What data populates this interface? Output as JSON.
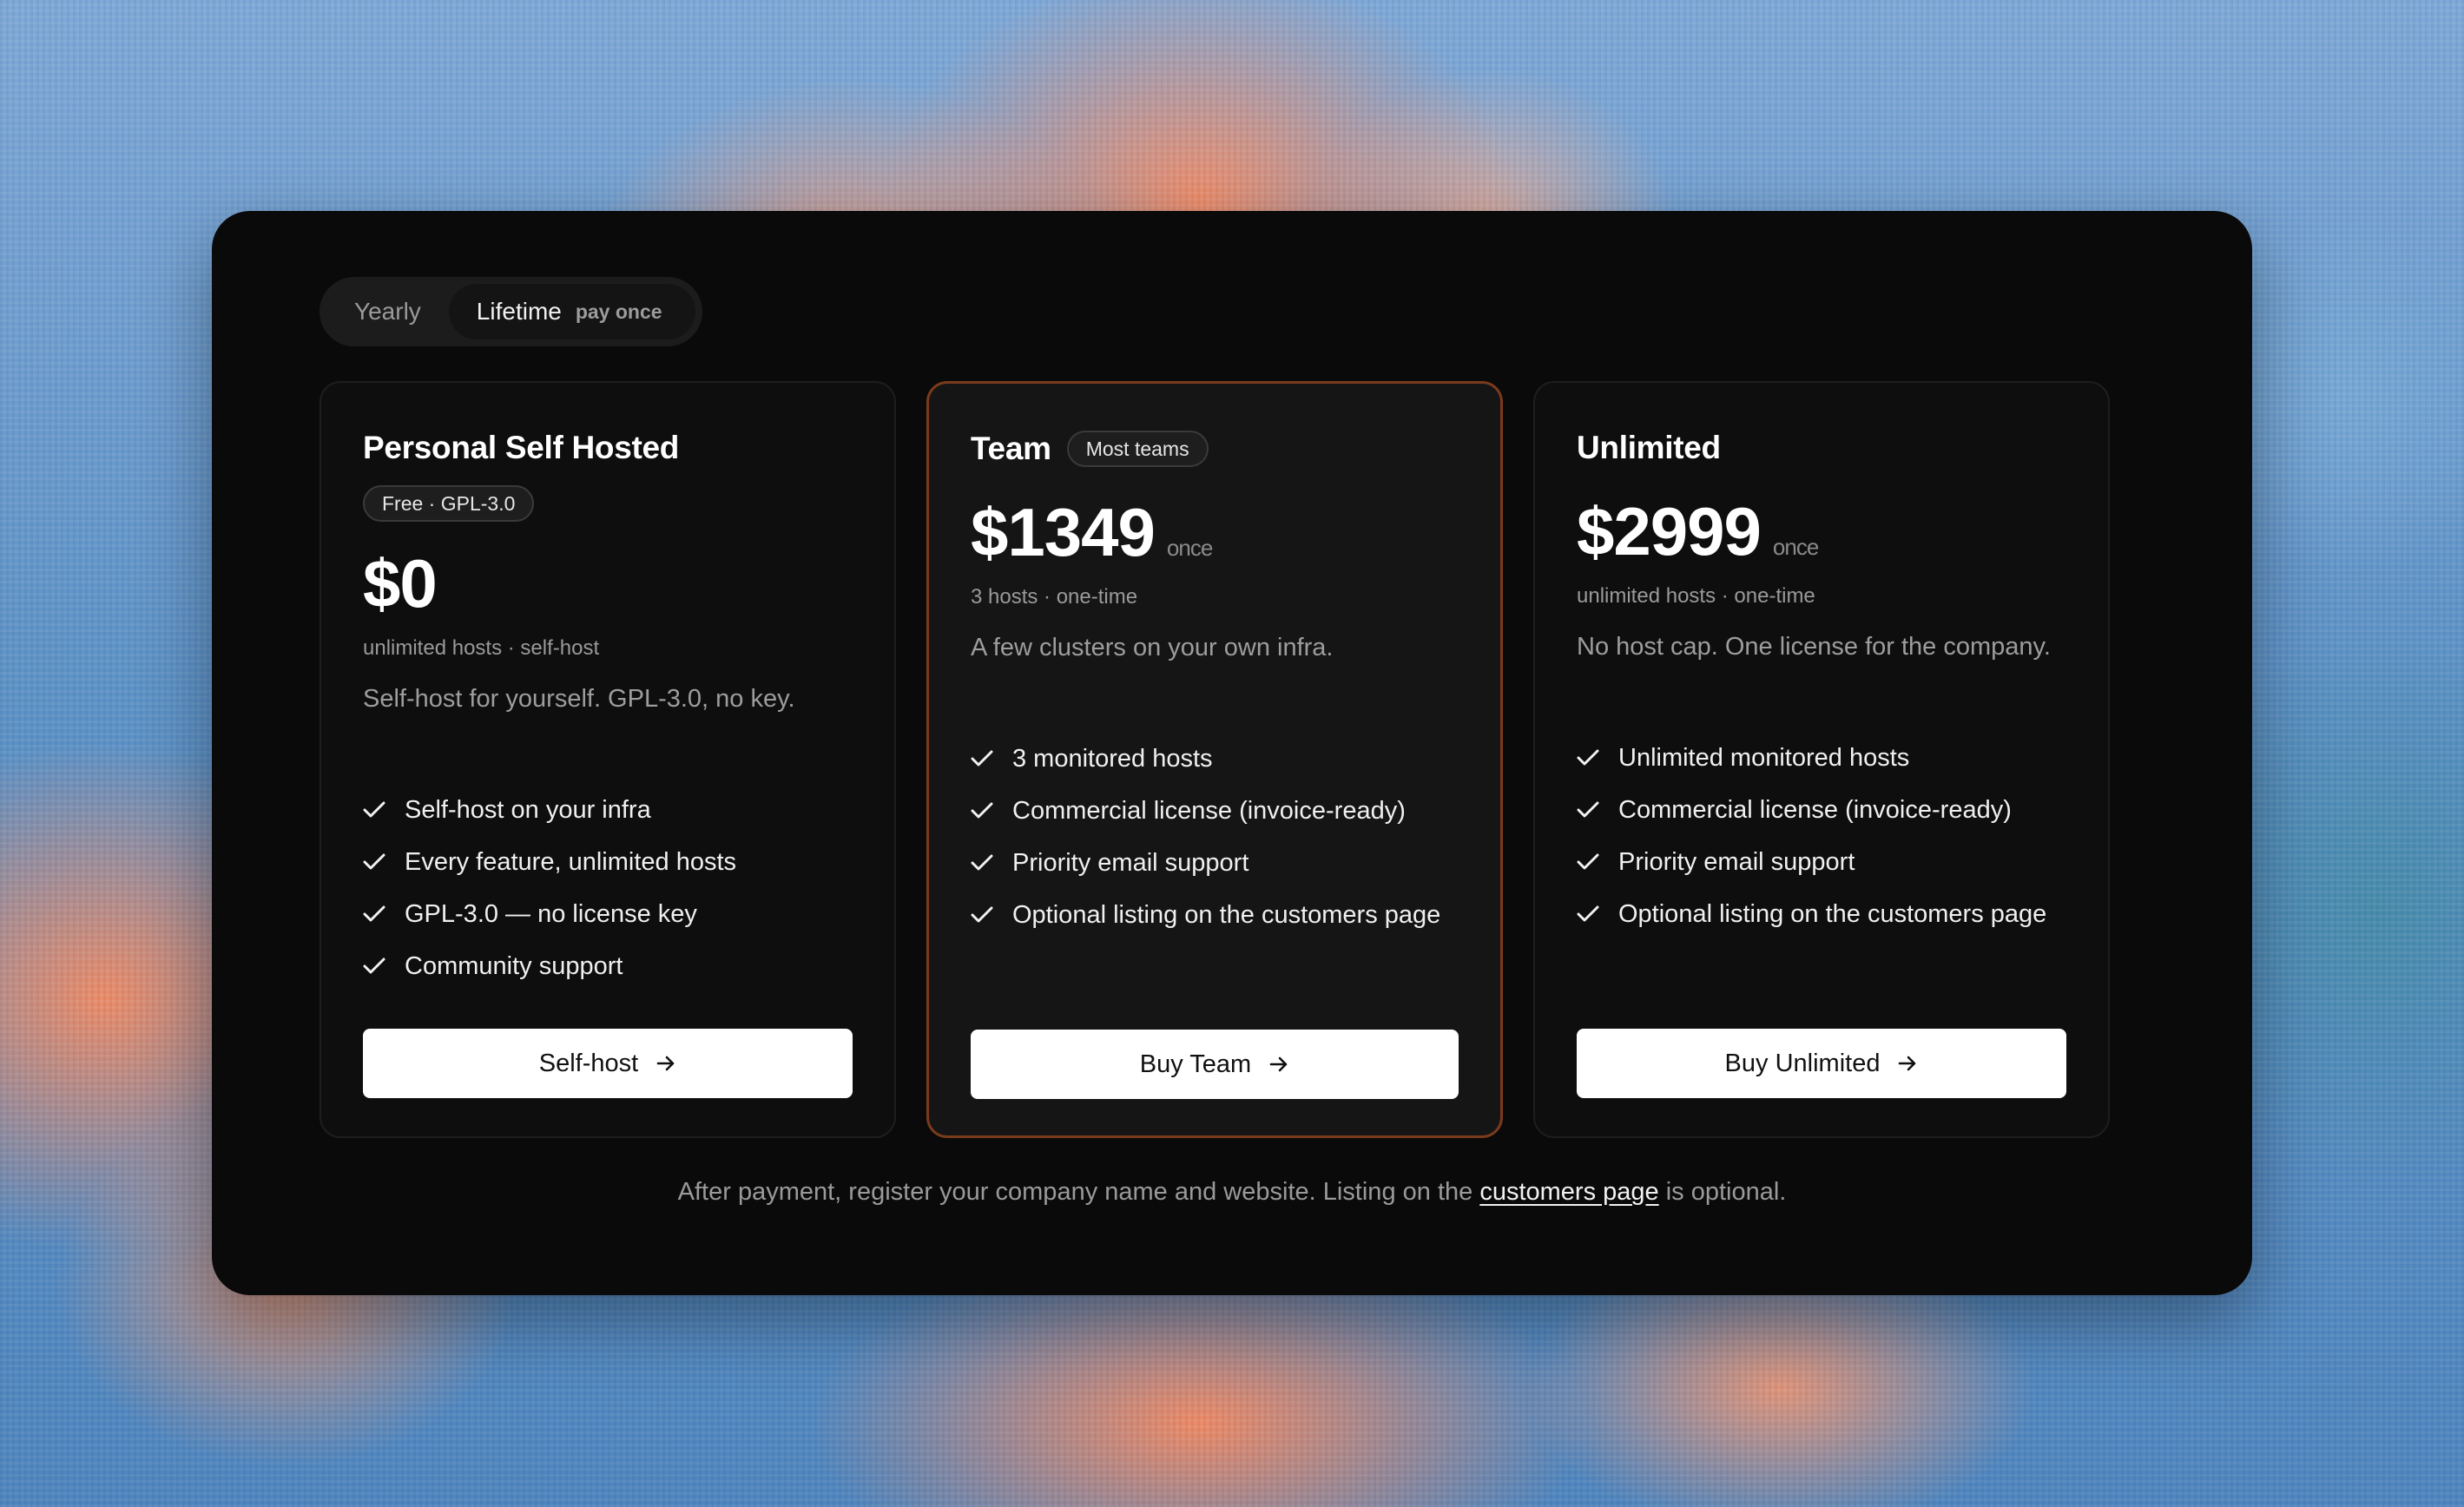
{
  "billing_toggle": {
    "yearly_label": "Yearly",
    "lifetime_label": "Lifetime",
    "lifetime_tag": "pay once",
    "selected": "Lifetime"
  },
  "plans": [
    {
      "name": "Personal Self Hosted",
      "badge": "Free · GPL-3.0",
      "price": "$0",
      "meta": "unlimited hosts · self-host",
      "description": "Self-host for yourself. GPL-3.0, no key.",
      "features": [
        "Self-host on your infra",
        "Every feature, unlimited hosts",
        "GPL-3.0 — no license key",
        "Community support"
      ],
      "cta": "Self-host"
    },
    {
      "name": "Team",
      "badge": "Most teams",
      "price": "$1349",
      "price_unit": "once",
      "meta": "3 hosts · one-time",
      "description": "A few clusters on your own infra.",
      "features": [
        "3 monitored hosts",
        "Commercial license (invoice-ready)",
        "Priority email support",
        "Optional listing on the customers page"
      ],
      "cta": "Buy Team"
    },
    {
      "name": "Unlimited",
      "price": "$2999",
      "price_unit": "once",
      "meta": "unlimited hosts · one-time",
      "description": "No host cap. One license for the company.",
      "features": [
        "Unlimited monitored hosts",
        "Commercial license (invoice-ready)",
        "Priority email support",
        "Optional listing on the customers page"
      ],
      "cta": "Buy Unlimited"
    }
  ],
  "footer": {
    "before_link": "After payment, register your company name and website. Listing on the ",
    "link_text": "customers page",
    "after_link": " is optional."
  },
  "colors": {
    "panel_bg": "#0a0a0a",
    "featured_border": "#7a3a1c",
    "cta_bg": "#ffffff"
  }
}
